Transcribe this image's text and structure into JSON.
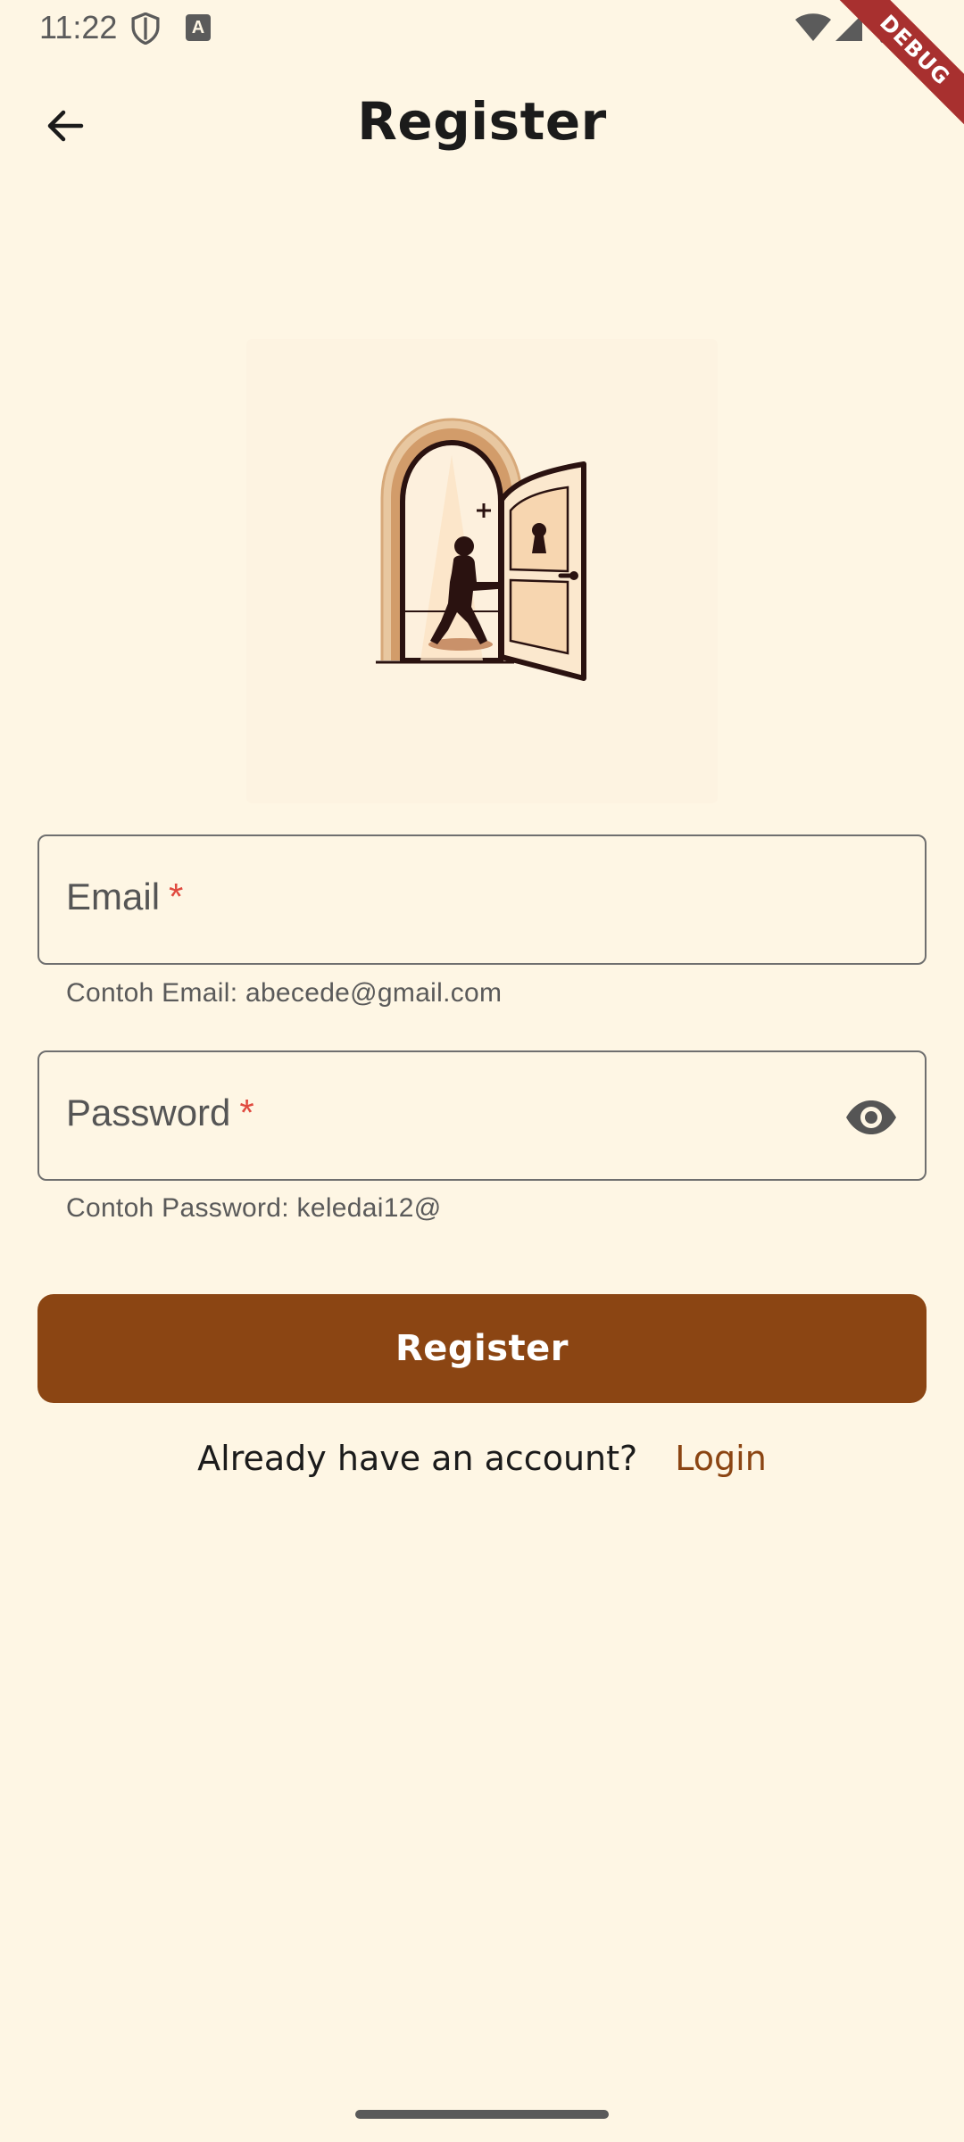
{
  "status_bar": {
    "time": "11:22",
    "notification_icon": "A"
  },
  "debug_banner": "DEBUG",
  "header": {
    "title": "Register",
    "back_icon": "arrow-left-icon"
  },
  "illustration": {
    "icon": "open-door-person-illustration"
  },
  "form": {
    "email": {
      "label": "Email",
      "required_marker": "*",
      "value": "",
      "helper": "Contoh Email: abecede@gmail.com"
    },
    "password": {
      "label": "Password",
      "required_marker": "*",
      "value": "",
      "helper": "Contoh Password: keledai12@",
      "toggle_icon": "eye-icon"
    },
    "submit_label": "Register"
  },
  "footer": {
    "prompt": "Already have an account?",
    "link": "Login"
  },
  "colors": {
    "background": "#FEF6E4",
    "primary": "#8B4513",
    "required": "#E04A3F",
    "debug": "#A8302F"
  }
}
